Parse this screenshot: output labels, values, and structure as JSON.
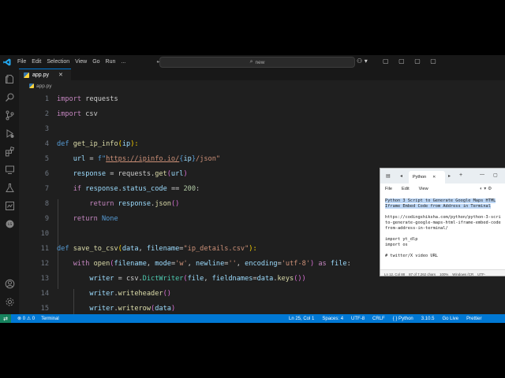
{
  "menu": [
    "File",
    "Edit",
    "Selection",
    "View",
    "Go",
    "Run",
    "..."
  ],
  "title_bar": {
    "nav": "← →",
    "command_center": "new",
    "layout": "▢ ▢ ▢ ▢"
  },
  "tab": {
    "label": "app.py",
    "close": "✕"
  },
  "breadcrumb": "app.py",
  "line_numbers": [
    "1",
    "2",
    "3",
    "4",
    "5",
    "6",
    "7",
    "8",
    "9",
    "10",
    "11",
    "12",
    "13",
    "14",
    "15"
  ],
  "code_lines": [
    [
      [
        "import",
        "kw"
      ],
      [
        " requests",
        "txt"
      ]
    ],
    [
      [
        "import",
        "kw"
      ],
      [
        " csv",
        "txt"
      ]
    ],
    [],
    [
      [
        "def",
        "def"
      ],
      [
        " ",
        "txt"
      ],
      [
        "get_ip_info",
        "fn"
      ],
      [
        "(",
        "brk"
      ],
      [
        "ip",
        "id"
      ],
      [
        "):",
        "brk"
      ]
    ],
    [
      [
        "    ",
        "txt"
      ],
      [
        "url",
        "id"
      ],
      [
        " = ",
        "txt"
      ],
      [
        "f\"",
        "def"
      ],
      [
        "https://ipinfo.io/",
        "link"
      ],
      [
        "{",
        "def"
      ],
      [
        "ip",
        "id"
      ],
      [
        "}",
        "def"
      ],
      [
        "/json\"",
        "str"
      ]
    ],
    [
      [
        "    ",
        "txt"
      ],
      [
        "response",
        "id"
      ],
      [
        " = requests.",
        "txt"
      ],
      [
        "get",
        "fn"
      ],
      [
        "(",
        "brk2"
      ],
      [
        "url",
        "id"
      ],
      [
        ")",
        "brk2"
      ]
    ],
    [
      [
        "    ",
        "txt"
      ],
      [
        "if",
        "kw"
      ],
      [
        " ",
        "txt"
      ],
      [
        "response",
        "id"
      ],
      [
        ".",
        "txt"
      ],
      [
        "status_code",
        "id"
      ],
      [
        " == ",
        "txt"
      ],
      [
        "200",
        "num"
      ],
      [
        ":",
        "txt"
      ]
    ],
    [
      [
        "        ",
        "txt"
      ],
      [
        "return",
        "kw"
      ],
      [
        " ",
        "txt"
      ],
      [
        "response",
        "id"
      ],
      [
        ".",
        "txt"
      ],
      [
        "json",
        "fn"
      ],
      [
        "()",
        "brk2"
      ]
    ],
    [
      [
        "    ",
        "txt"
      ],
      [
        "return",
        "kw"
      ],
      [
        " ",
        "txt"
      ],
      [
        "None",
        "def"
      ]
    ],
    [],
    [
      [
        "def",
        "def"
      ],
      [
        " ",
        "txt"
      ],
      [
        "save_to_csv",
        "fn"
      ],
      [
        "(",
        "brk"
      ],
      [
        "data",
        "id"
      ],
      [
        ", ",
        "txt"
      ],
      [
        "filename",
        "id"
      ],
      [
        "=",
        "txt"
      ],
      [
        "\"ip_details.csv\"",
        "str"
      ],
      [
        "):",
        "brk"
      ]
    ],
    [
      [
        "    ",
        "txt"
      ],
      [
        "with",
        "kw"
      ],
      [
        " ",
        "txt"
      ],
      [
        "open",
        "fn"
      ],
      [
        "(",
        "brk2"
      ],
      [
        "filename",
        "id"
      ],
      [
        ", ",
        "txt"
      ],
      [
        "mode",
        "id"
      ],
      [
        "=",
        "txt"
      ],
      [
        "'w'",
        "str"
      ],
      [
        ", ",
        "txt"
      ],
      [
        "newline",
        "id"
      ],
      [
        "=",
        "txt"
      ],
      [
        "''",
        "str"
      ],
      [
        ", ",
        "txt"
      ],
      [
        "encoding",
        "id"
      ],
      [
        "=",
        "txt"
      ],
      [
        "'utf-8'",
        "str"
      ],
      [
        ") ",
        "brk2"
      ],
      [
        "as",
        "kw"
      ],
      [
        " ",
        "txt"
      ],
      [
        "file",
        "id"
      ],
      [
        ":",
        "txt"
      ]
    ],
    [
      [
        "        ",
        "txt"
      ],
      [
        "writer",
        "id"
      ],
      [
        " = csv.",
        "txt"
      ],
      [
        "DictWriter",
        "cls"
      ],
      [
        "(",
        "brk2"
      ],
      [
        "file",
        "id"
      ],
      [
        ", ",
        "txt"
      ],
      [
        "fieldnames",
        "id"
      ],
      [
        "=",
        "txt"
      ],
      [
        "data",
        "id"
      ],
      [
        ".",
        "txt"
      ],
      [
        "keys",
        "fn"
      ],
      [
        "())",
        "brk2"
      ]
    ],
    [
      [
        "        ",
        "txt"
      ],
      [
        "writer",
        "id"
      ],
      [
        ".",
        "txt"
      ],
      [
        "writeheader",
        "fn"
      ],
      [
        "()",
        "brk2"
      ]
    ],
    [
      [
        "        ",
        "txt"
      ],
      [
        "writer",
        "id"
      ],
      [
        ".",
        "txt"
      ],
      [
        "writerow",
        "fn"
      ],
      [
        "(",
        "brk2"
      ],
      [
        "data",
        "id"
      ],
      [
        ")",
        "brk2"
      ]
    ]
  ],
  "status_left": {
    "errors": "⊗ 0 ⚠ 0",
    "terminal": "Terminal"
  },
  "status_right": [
    "Ln 25, Col 1",
    "Spaces: 4",
    "UTF-8",
    "CRLF",
    "{ } Python",
    "3.10.5",
    "Go Live",
    "Prettier"
  ],
  "notepad": {
    "tab_label": "Python",
    "menus": [
      "File",
      "Edit",
      "View"
    ],
    "lines": [
      {
        "text": "Python 3 Script to Generate Google Maps HTML",
        "selected": true
      },
      {
        "text": "Iframe Embed Code from Address in Terminal",
        "selected": true
      },
      {
        "text": "",
        "selected": false
      },
      {
        "text": "https://codingshiksha.com/python/python-3-scri",
        "selected": false
      },
      {
        "text": "to-generate-google-maps-html-iframe-embed-code",
        "selected": false
      },
      {
        "text": "from-address-in-terminal/",
        "selected": false
      },
      {
        "text": "",
        "selected": false
      },
      {
        "text": "import yt_dlp",
        "selected": false
      },
      {
        "text": "import os",
        "selected": false
      },
      {
        "text": "",
        "selected": false
      },
      {
        "text": "# twitter/X video URL",
        "selected": false
      }
    ],
    "status": [
      "Ln 12, Col 88",
      "87 of 7,262 chars",
      "100%",
      "Windows (CR",
      "UTF-"
    ]
  },
  "colors": {
    "accent": "#0078d4",
    "editor_bg": "#1f1f1f",
    "remote": "#16825d"
  }
}
